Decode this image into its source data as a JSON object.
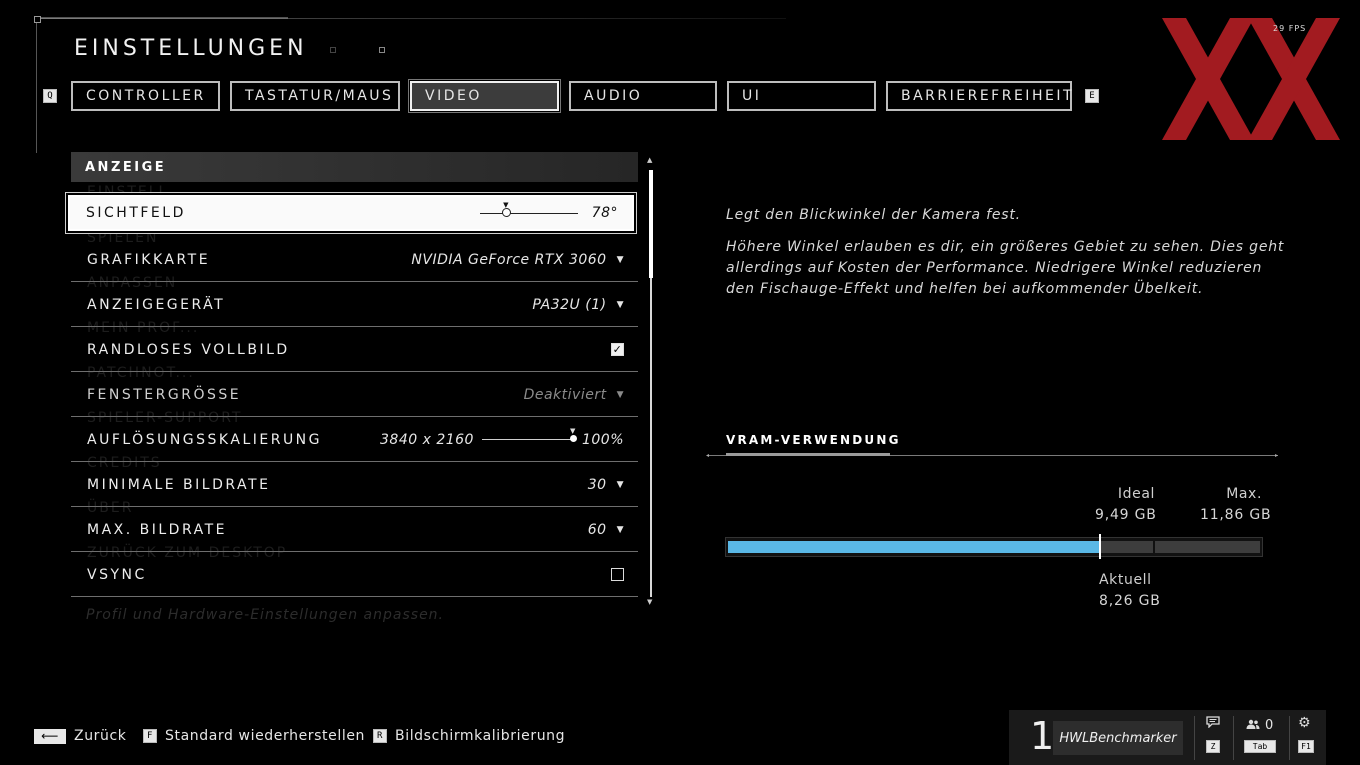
{
  "fps": "29 FPS",
  "header": {
    "title": "EINSTELLUNGEN",
    "prev_key": "Q",
    "next_key": "E"
  },
  "tabs": [
    {
      "label": "CONTROLLER"
    },
    {
      "label": "TASTATUR/MAUS"
    },
    {
      "label": "VIDEO",
      "active": true
    },
    {
      "label": "AUDIO"
    },
    {
      "label": "UI"
    },
    {
      "label": "BARRIEREFREIHEIT"
    }
  ],
  "section": {
    "title": "ANZEIGE"
  },
  "background_menu": [
    "EINSTELL...",
    "SPIELEN",
    "ANPASSEN",
    "MEIN PROF...",
    "PATCHNOT...",
    "SPIELER-SUPPORT",
    "CREDITS",
    "ÜBER",
    "ZURÜCK ZUM DESKTOP"
  ],
  "settings": [
    {
      "label": "SICHTFELD",
      "value": "78°",
      "type": "slider",
      "slider_fraction": 0.28
    },
    {
      "label": "GRAFIKKARTE",
      "value": "NVIDIA GeForce RTX 3060",
      "type": "dropdown"
    },
    {
      "label": "ANZEIGEGERÄT",
      "value": "PA32U (1)",
      "type": "dropdown"
    },
    {
      "label": "RANDLOSES VOLLBILD",
      "type": "checkbox",
      "checked": true,
      "mark": "✓"
    },
    {
      "label": "FENSTERGRÖSSE",
      "value": "Deaktiviert",
      "type": "dropdown",
      "disabled": true
    },
    {
      "label": "AUFLÖSUNGSSKALIERUNG",
      "resolution": "3840 x 2160",
      "value": "100%",
      "type": "slider",
      "slider_fraction": 1.0
    },
    {
      "label": "MINIMALE BILDRATE",
      "value": "30",
      "type": "dropdown"
    },
    {
      "label": "MAX. BILDRATE",
      "value": "60",
      "type": "dropdown"
    },
    {
      "label": "VSYNC",
      "type": "checkbox",
      "checked": false,
      "mark": ""
    }
  ],
  "arrow_glyph": "▼",
  "hint": "Profil und Hardware-Einstellungen anpassen.",
  "description": {
    "short": "Legt den Blickwinkel der Kamera fest.",
    "long": "Höhere Winkel erlauben es dir, ein größeres Gebiet zu sehen. Dies geht allerdings auf Kosten der Performance. Niedrigere Winkel reduzieren den Fischauge-Effekt und helfen bei aufkommender Übelkeit."
  },
  "vram": {
    "title": "VRAM-VERWENDUNG",
    "ideal_label": "Ideal",
    "ideal_value": "9,49 GB",
    "max_label": "Max.",
    "max_value": "11,86 GB",
    "current_label": "Aktuell",
    "current_value": "8,26 GB",
    "current_gb": 8.26,
    "ideal_gb": 9.49,
    "max_gb": 11.86,
    "fill_color": "#5ab8e6"
  },
  "footer": {
    "back_label": "Zurück",
    "reset_key": "F",
    "reset_label": "Standard wiederherstellen",
    "calib_key": "R",
    "calib_label": "Bildschirmkalibrierung"
  },
  "profile": {
    "rank": "1",
    "gamertag": "HWLBenchmarker",
    "chat_key": "Z",
    "friends_count": "0",
    "friends_key": "Tab",
    "settings_key": "F1"
  },
  "brand_color": "#b01e23"
}
